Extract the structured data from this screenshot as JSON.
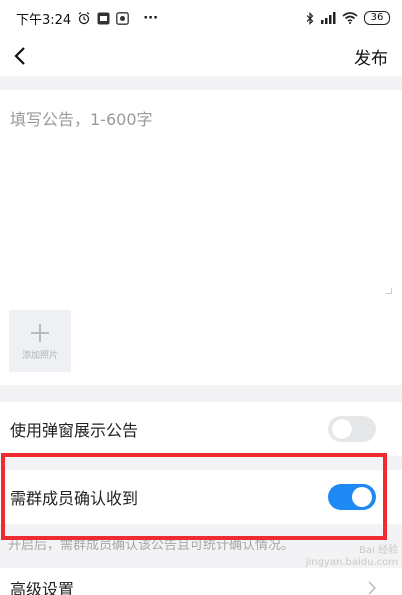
{
  "status_bar": {
    "time": "下午3:24",
    "more": "···",
    "battery": "36"
  },
  "nav": {
    "publish_label": "发布"
  },
  "editor": {
    "placeholder": "填写公告，1-600字",
    "add_photo_label": "添加照片"
  },
  "settings": {
    "popup_label": "使用弹窗展示公告",
    "popup_enabled": false,
    "confirm_label": "需群成员确认收到",
    "confirm_enabled": true,
    "confirm_hint": "开启后，需群成员确认该公告且可统计确认情况。",
    "advanced_label": "高级设置"
  },
  "watermark": {
    "line1": "Bai 经验",
    "line2": "jingyan.baidu.com"
  },
  "colors": {
    "accent": "#1e88f5",
    "highlight_box": "#ef2b32"
  }
}
